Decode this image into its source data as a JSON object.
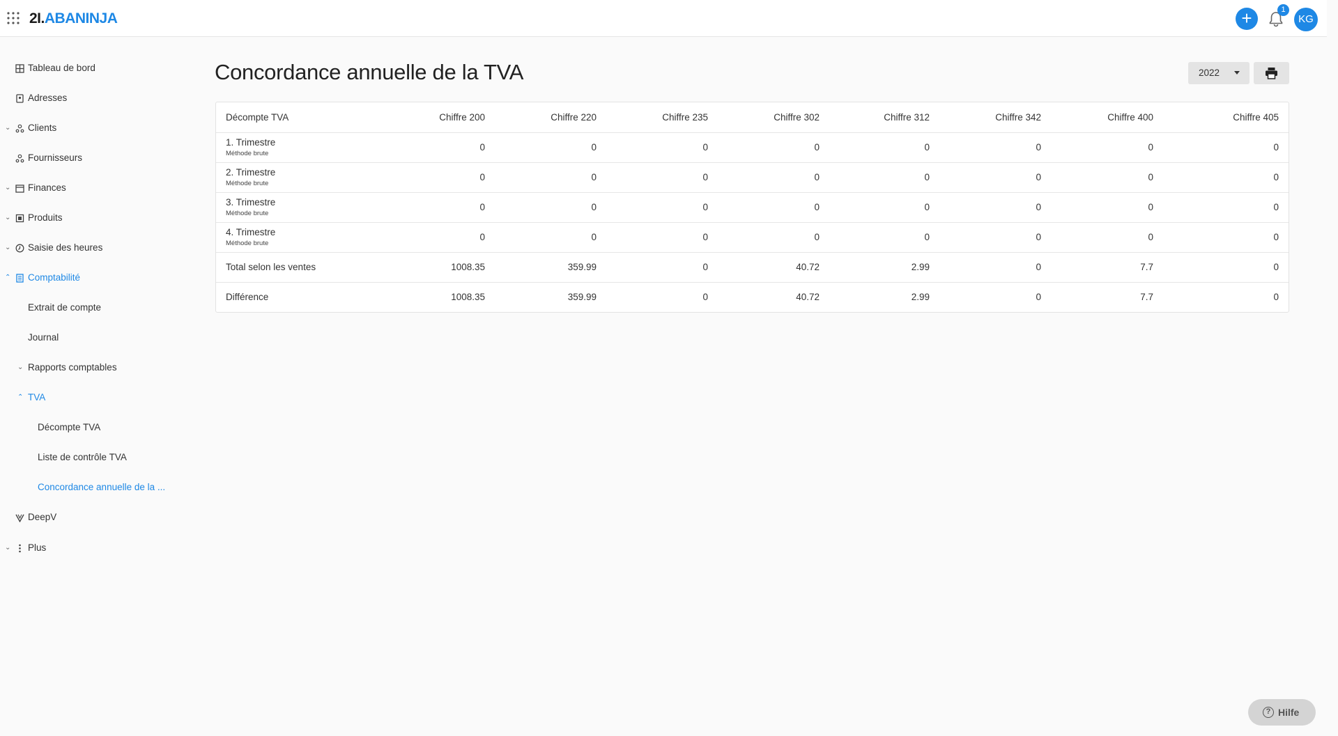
{
  "header": {
    "brand_number": "2I.",
    "brand_name": "ABANINJA",
    "notification_count": "1",
    "avatar_initials": "KG",
    "add_label": "+"
  },
  "sidebar": {
    "items": [
      {
        "label": "Tableau de bord",
        "icon": "dashboard-icon"
      },
      {
        "label": "Adresses",
        "icon": "address-book-icon"
      },
      {
        "label": "Clients",
        "icon": "clients-icon"
      },
      {
        "label": "Fournisseurs",
        "icon": "suppliers-icon"
      },
      {
        "label": "Finances",
        "icon": "calendar-icon"
      },
      {
        "label": "Produits",
        "icon": "product-icon"
      },
      {
        "label": "Saisie des heures",
        "icon": "clock-icon"
      },
      {
        "label": "Comptabilité",
        "icon": "accounting-icon"
      },
      {
        "label": "Extrait de compte"
      },
      {
        "label": "Journal"
      },
      {
        "label": "Rapports comptables"
      },
      {
        "label": "TVA"
      },
      {
        "label": "Décompte TVA"
      },
      {
        "label": "Liste de contrôle TVA"
      },
      {
        "label": "Concordance annuelle de la ..."
      },
      {
        "label": "DeepV",
        "icon": "deepv-icon"
      },
      {
        "label": "Plus",
        "icon": "more-vertical-icon"
      }
    ]
  },
  "main": {
    "title": "Concordance annuelle de la TVA",
    "year": "2022",
    "table": {
      "headers": [
        "Décompte TVA",
        "Chiffre 200",
        "Chiffre 220",
        "Chiffre 235",
        "Chiffre 302",
        "Chiffre 312",
        "Chiffre 342",
        "Chiffre 400",
        "Chiffre 405"
      ],
      "quarter_rows": [
        {
          "label": "1. Trimestre",
          "sub": "Méthode brute",
          "values": [
            "0",
            "0",
            "0",
            "0",
            "0",
            "0",
            "0",
            "0"
          ]
        },
        {
          "label": "2. Trimestre",
          "sub": "Méthode brute",
          "values": [
            "0",
            "0",
            "0",
            "0",
            "0",
            "0",
            "0",
            "0"
          ]
        },
        {
          "label": "3. Trimestre",
          "sub": "Méthode brute",
          "values": [
            "0",
            "0",
            "0",
            "0",
            "0",
            "0",
            "0",
            "0"
          ]
        },
        {
          "label": "4. Trimestre",
          "sub": "Méthode brute",
          "values": [
            "0",
            "0",
            "0",
            "0",
            "0",
            "0",
            "0",
            "0"
          ]
        }
      ],
      "total_row": {
        "label": "Total selon les ventes",
        "values": [
          "1008.35",
          "359.99",
          "0",
          "40.72",
          "2.99",
          "0",
          "7.7",
          "0"
        ]
      },
      "diff_row": {
        "label": "Différence",
        "values": [
          "1008.35",
          "359.99",
          "0",
          "40.72",
          "2.99",
          "0",
          "7.7",
          "0"
        ]
      }
    }
  },
  "help": {
    "label": "Hilfe"
  },
  "colors": {
    "accent": "#1e88e5",
    "background": "#fafafa"
  }
}
